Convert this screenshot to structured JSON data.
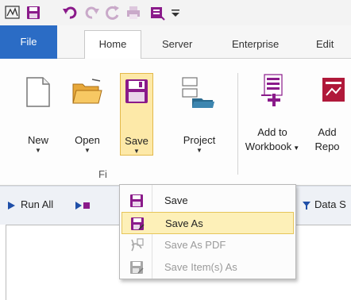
{
  "quick_access": {
    "icons": [
      "app-icon",
      "save-icon",
      "undo-icon",
      "redo-icon",
      "refresh-icon",
      "print-icon",
      "customize-icon",
      "qat-dropdown-icon"
    ]
  },
  "tabs": [
    {
      "label": "File"
    },
    {
      "label": "Home"
    },
    {
      "label": "Server"
    },
    {
      "label": "Enterprise"
    },
    {
      "label": "Edit"
    }
  ],
  "ribbon": {
    "buttons": {
      "new": "New",
      "open": "Open",
      "save": "Save",
      "project": "Project",
      "add_workbook_line1": "Add to",
      "add_workbook_line2": "Workbook",
      "add_report_line1": "Add",
      "add_report_line2": "Repo"
    },
    "group_label": "Fi"
  },
  "cmdbar": {
    "run_all": "Run All",
    "data_source": "Data S"
  },
  "save_menu": {
    "items": [
      {
        "label": "Save",
        "enabled": true
      },
      {
        "label": "Save As",
        "enabled": true,
        "highlighted": true
      },
      {
        "label": "Save As PDF",
        "enabled": false
      },
      {
        "label": "Save Item(s) As",
        "enabled": false
      }
    ]
  },
  "colors": {
    "file_tab": "#2b6cc5",
    "highlight": "#fde9a8",
    "accent_purple": "#8a1a8a",
    "accent_red": "#b0193a"
  }
}
